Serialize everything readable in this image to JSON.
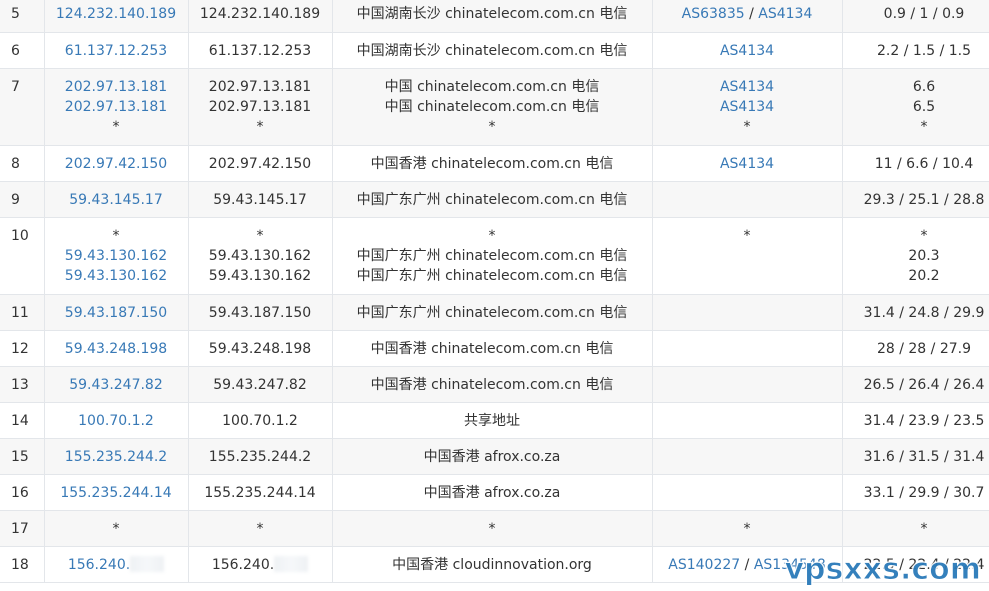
{
  "rows": [
    {
      "hop": "5",
      "ip": [
        "124.232.140.189"
      ],
      "host": [
        "124.232.140.189"
      ],
      "location": [
        "中国湖南长沙 chinatelecom.com.cn 电信"
      ],
      "asn": [
        [
          "AS63835",
          "AS4134"
        ]
      ],
      "time": [
        "0.9 / 1 / 0.9"
      ]
    },
    {
      "hop": "6",
      "ip": [
        "61.137.12.253"
      ],
      "host": [
        "61.137.12.253"
      ],
      "location": [
        "中国湖南长沙 chinatelecom.com.cn 电信"
      ],
      "asn": [
        [
          "AS4134"
        ]
      ],
      "time": [
        "2.2 / 1.5 / 1.5"
      ]
    },
    {
      "hop": "7",
      "ip": [
        "202.97.13.181",
        "202.97.13.181",
        "*"
      ],
      "host": [
        "202.97.13.181",
        "202.97.13.181",
        "*"
      ],
      "location": [
        "中国 chinatelecom.com.cn 电信",
        "中国 chinatelecom.com.cn 电信",
        "*"
      ],
      "asn": [
        [
          "AS4134"
        ],
        [
          "AS4134"
        ],
        [
          "*"
        ]
      ],
      "time": [
        "6.6",
        "6.5",
        "*"
      ]
    },
    {
      "hop": "8",
      "ip": [
        "202.97.42.150"
      ],
      "host": [
        "202.97.42.150"
      ],
      "location": [
        "中国香港 chinatelecom.com.cn 电信"
      ],
      "asn": [
        [
          "AS4134"
        ]
      ],
      "time": [
        "11 / 6.6 / 10.4"
      ]
    },
    {
      "hop": "9",
      "ip": [
        "59.43.145.17"
      ],
      "host": [
        "59.43.145.17"
      ],
      "location": [
        "中国广东广州 chinatelecom.com.cn 电信"
      ],
      "asn": [],
      "time": [
        "29.3 / 25.1 / 28.8"
      ]
    },
    {
      "hop": "10",
      "ip": [
        "*",
        "59.43.130.162",
        "59.43.130.162"
      ],
      "host": [
        "*",
        "59.43.130.162",
        "59.43.130.162"
      ],
      "location": [
        "*",
        "中国广东广州 chinatelecom.com.cn 电信",
        "中国广东广州 chinatelecom.com.cn 电信"
      ],
      "asn": [
        [
          "*"
        ]
      ],
      "time": [
        "*",
        "20.3",
        "20.2"
      ]
    },
    {
      "hop": "11",
      "ip": [
        "59.43.187.150"
      ],
      "host": [
        "59.43.187.150"
      ],
      "location": [
        "中国广东广州 chinatelecom.com.cn 电信"
      ],
      "asn": [],
      "time": [
        "31.4 / 24.8 / 29.9"
      ]
    },
    {
      "hop": "12",
      "ip": [
        "59.43.248.198"
      ],
      "host": [
        "59.43.248.198"
      ],
      "location": [
        "中国香港 chinatelecom.com.cn 电信"
      ],
      "asn": [],
      "time": [
        "28 / 28 / 27.9"
      ]
    },
    {
      "hop": "13",
      "ip": [
        "59.43.247.82"
      ],
      "host": [
        "59.43.247.82"
      ],
      "location": [
        "中国香港 chinatelecom.com.cn 电信"
      ],
      "asn": [],
      "time": [
        "26.5 / 26.4 / 26.4"
      ]
    },
    {
      "hop": "14",
      "ip": [
        "100.70.1.2"
      ],
      "host": [
        "100.70.1.2"
      ],
      "location": [
        "共享地址"
      ],
      "asn": [],
      "time": [
        "31.4 / 23.9 / 23.5"
      ]
    },
    {
      "hop": "15",
      "ip": [
        "155.235.244.2"
      ],
      "host": [
        "155.235.244.2"
      ],
      "location": [
        "中国香港 afrox.co.za"
      ],
      "asn": [],
      "time": [
        "31.6 / 31.5 / 31.4"
      ]
    },
    {
      "hop": "16",
      "ip": [
        "155.235.244.14"
      ],
      "host": [
        "155.235.244.14"
      ],
      "location": [
        "中国香港 afrox.co.za"
      ],
      "asn": [],
      "time": [
        "33.1 / 29.9 / 30.7"
      ]
    },
    {
      "hop": "17",
      "ip": [
        "*"
      ],
      "host": [
        "*"
      ],
      "location": [
        "*"
      ],
      "asn": [
        [
          "*"
        ]
      ],
      "time": [
        "*"
      ]
    },
    {
      "hop": "18",
      "ip": [
        "156.240."
      ],
      "host": [
        "156.240."
      ],
      "location": [
        "中国香港 cloudinnovation.org"
      ],
      "asn": [
        [
          "AS140227",
          "AS134548"
        ]
      ],
      "time": [
        "22.5 / 22.4 / 22.4"
      ],
      "redacted": true
    }
  ],
  "watermark": "vpsxxs.com"
}
